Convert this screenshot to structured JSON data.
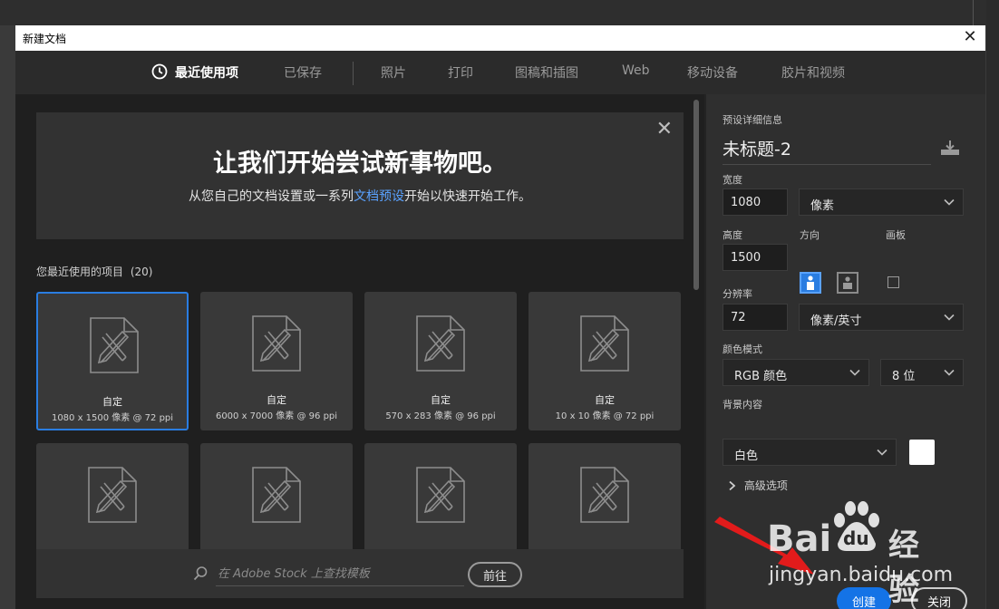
{
  "dialog": {
    "title": "新建文档",
    "close_glyph": "✕"
  },
  "tabs": [
    {
      "label": "最近使用项",
      "active": true
    },
    {
      "label": "已保存"
    },
    {
      "label": "照片"
    },
    {
      "label": "打印"
    },
    {
      "label": "图稿和插图"
    },
    {
      "label": "Web"
    },
    {
      "label": "移动设备"
    },
    {
      "label": "胶片和视频"
    }
  ],
  "banner": {
    "heading": "让我们开始尝试新事物吧。",
    "text_before": "从您自己的文档设置或一系列",
    "link": "文档预设",
    "text_after": "开始以快速开始工作。",
    "dismiss_glyph": "✕"
  },
  "recent": {
    "title": "您最近使用的项目",
    "count": "(20)",
    "items": [
      {
        "name": "自定",
        "size": "1080 x 1500 像素 @ 72 ppi",
        "selected": true
      },
      {
        "name": "自定",
        "size": "6000 x 7000 像素 @ 96 ppi"
      },
      {
        "name": "自定",
        "size": "570 x 283 像素 @ 96 ppi"
      },
      {
        "name": "自定",
        "size": "10 x 10 像素 @ 72 ppi"
      },
      {
        "name": "",
        "size": ""
      },
      {
        "name": "",
        "size": ""
      },
      {
        "name": "",
        "size": ""
      },
      {
        "name": "",
        "size": ""
      }
    ]
  },
  "search": {
    "placeholder": "在 Adobe Stock 上查找模板",
    "go_label": "前往"
  },
  "details": {
    "section_title": "预设详细信息",
    "preset_name": "未标题-2",
    "width_label": "宽度",
    "width_value": "1080",
    "width_unit": "像素",
    "height_label": "高度",
    "height_value": "1500",
    "orientation_label": "方向",
    "artboard_label": "画板",
    "resolution_label": "分辨率",
    "resolution_value": "72",
    "resolution_unit": "像素/英寸",
    "color_mode_label": "颜色模式",
    "color_mode": "RGB 颜色",
    "bit_depth": "8 位",
    "background_label": "背景内容",
    "background": "白色",
    "background_color": "#ffffff",
    "advanced_label": "高级选项",
    "create_label": "创建",
    "close_label": "关闭"
  },
  "watermark": {
    "brand_left": "Bai",
    "brand_mid": "du",
    "brand_right": "经验",
    "url": "jingyan.baidu.com"
  },
  "colors": {
    "accent": "#1473e6",
    "link": "#5aa2ff"
  }
}
